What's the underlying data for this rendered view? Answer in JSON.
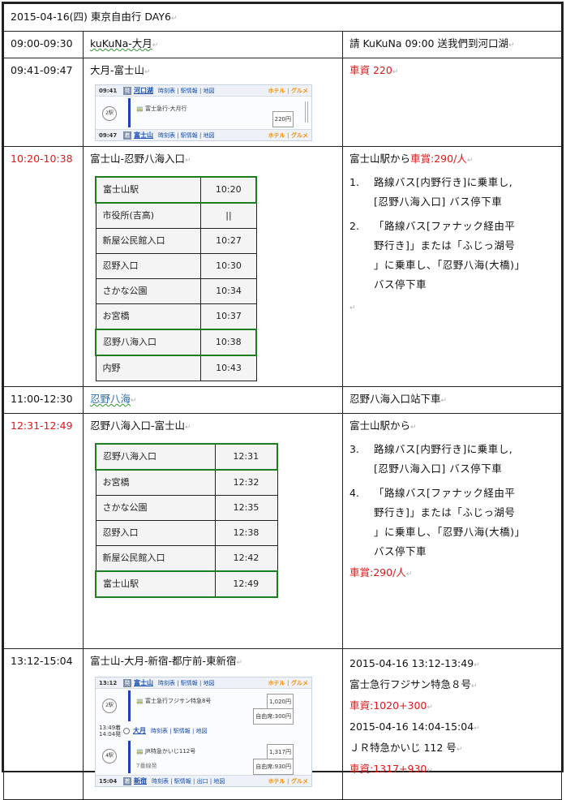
{
  "header": "2015-04-16(四) 東京自由行 DAY6",
  "rows": [
    {
      "time": "09:00-09:30",
      "route": "kuKuNa-大月",
      "note": "請 KuKuNa 09:00 送我們到河口湖"
    },
    {
      "time": "09:41-09:47",
      "route": "大月-富士山",
      "note": "車資 220",
      "panel": {
        "dep_time": "09:41",
        "dep_station": "河口湖",
        "links": "時刻表 | 駅情報 | 地図",
        "logo": "ホテル | グルメ",
        "train": "富士急行-大月行",
        "fare": "220円",
        "arr_time": "09:47",
        "arr_station": "富士山"
      }
    },
    {
      "time": "10:20-10:38",
      "route": "富士山-忍野八海入口",
      "timetable": [
        [
          "富士山駅",
          "10:20"
        ],
        [
          "市役所(吉高)",
          "||"
        ],
        [
          "新屋公民館入口",
          "10:27"
        ],
        [
          "忍野入口",
          "10:30"
        ],
        [
          "さかな公園",
          "10:34"
        ],
        [
          "お宮橋",
          "10:37"
        ],
        [
          "忍野八海入口",
          "10:38"
        ],
        [
          "内野",
          "10:43"
        ]
      ],
      "note_head_1": "富士山駅から",
      "note_head_fare": "車賞:290/人",
      "steps": [
        {
          "num": "1.",
          "lines": [
            "路線バス[内野行き]に乗車し,",
            "[忍野八海入口] バス停下車"
          ]
        },
        {
          "num": "2.",
          "lines": [
            "「路線バス[ファナック経由平",
            "野行き]」または「ふじっ湖号",
            "」に乗車し、「忍野八海(大橋)」",
            "バス停下車"
          ]
        }
      ]
    },
    {
      "time": "11:00-12:30",
      "route": "忍野八海",
      "note": "忍野八海入口站下車"
    },
    {
      "time": "12:31-12:49",
      "route": "忍野八海入口-富士山",
      "timetable": [
        [
          "忍野八海入口",
          "12:31"
        ],
        [
          "お宮橋",
          "12:32"
        ],
        [
          "さかな公園",
          "12:35"
        ],
        [
          "忍野入口",
          "12:38"
        ],
        [
          "新屋公民館入口",
          "12:42"
        ],
        [
          "富士山駅",
          "12:49"
        ]
      ],
      "note_head": "富士山駅から",
      "steps": [
        {
          "num": "3.",
          "lines": [
            "路線バス[内野行き]に乗車し,",
            "[忍野八海入口] バス停下車"
          ]
        },
        {
          "num": "4.",
          "lines": [
            "「路線バス[ファナック経由平",
            "野行き]」または「ふじっ湖号",
            "」に乗車し、「忍野八海(大橋)」",
            "バス停下車"
          ]
        }
      ],
      "fare": "車賞:290/人"
    },
    {
      "time": "13:12-15:04",
      "route": "富士山-大月-新宿-都庁前-東新宿",
      "panel2": {
        "t1": "13:12",
        "s1": "富士山",
        "train1": "富士急行フジサン特急8号",
        "fare1": "1,020円",
        "seat1": "自由席:300円",
        "t2a": "13:49着",
        "t2b": "14:04発",
        "s2": "大月",
        "train2": "JR特急かいじ112号",
        "sub2": "7番線発",
        "fare2": "1,317円",
        "seat2": "自由席:930円",
        "t3": "15:04",
        "s3": "新宿",
        "links": "時刻表 | 駅情報 | 地図",
        "links3": "時刻表 | 駅情報 | 出口 | 地図",
        "circ1": "2駅",
        "circ2": "4駅"
      },
      "lines": [
        "2015-04-16 13:12-13:49",
        "富士急行フジサン特急８号",
        "車資:1020+300",
        "2015-04-16 14:04-15:04",
        "ＪＲ特急かいじ 112 号",
        "車資:1317+930"
      ]
    }
  ]
}
